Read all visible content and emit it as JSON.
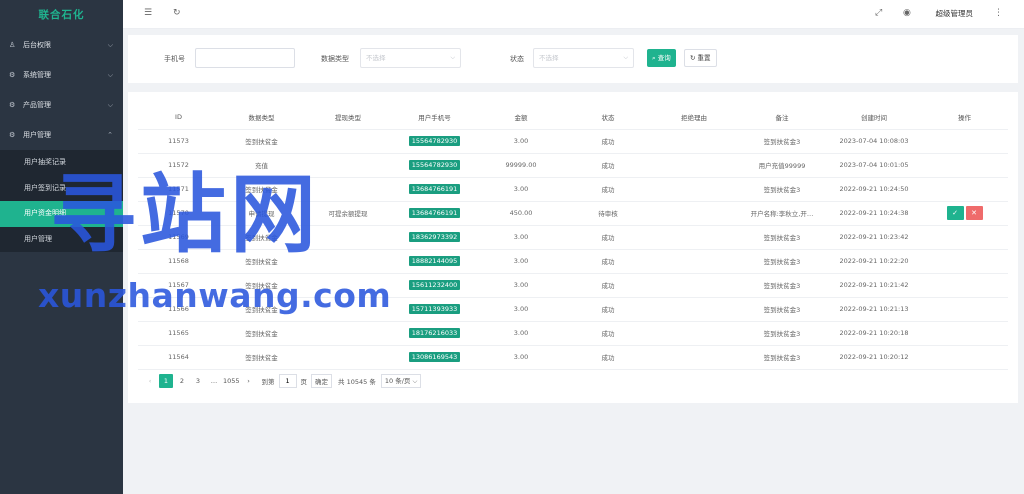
{
  "brand": "联合石化",
  "sidebar": {
    "menus": [
      {
        "label": "后台权限",
        "icon": "person-icon",
        "glyph": "♙",
        "chevron": "⌵"
      },
      {
        "label": "系统管理",
        "icon": "gear-icon",
        "glyph": "⚙",
        "chevron": "⌵"
      },
      {
        "label": "产品管理",
        "icon": "gear-icon",
        "glyph": "⚙",
        "chevron": "⌵"
      },
      {
        "label": "用户管理",
        "icon": "gear-icon",
        "glyph": "⚙",
        "chevron": "⌃"
      }
    ],
    "submenu": [
      "用户抽奖记录",
      "用户签到记录",
      "用户资金明细",
      "用户管理"
    ],
    "active_submenu": 2
  },
  "header": {
    "menu_toggle_glyph": "☰",
    "refresh_glyph": "↻",
    "fullscreen_glyph": "⤢",
    "theme_glyph": "◉",
    "user": "超级管理员",
    "more_glyph": "⋮"
  },
  "filter": {
    "phone_label": "手机号",
    "phone_value": "",
    "type_label": "数据类型",
    "type_placeholder": "不选择",
    "status_label": "状态",
    "status_placeholder": "不选择",
    "query_label": "查询",
    "reset_label": "重置",
    "search_glyph": "⌕",
    "reset_glyph": "↻",
    "dropdown_glyph": "⌵"
  },
  "table": {
    "columns": [
      "ID",
      "数据类型",
      "提现类型",
      "用户手机号",
      "金额",
      "状态",
      "拒绝理由",
      "备注",
      "创建时间",
      "操作"
    ],
    "rows": [
      {
        "id": "11573",
        "type": "签到扶贫金",
        "withdraw": "",
        "phone": "15564782930",
        "amount": "3.00",
        "status": "成功",
        "reason": "",
        "note": "签到扶贫金3",
        "time": "2023-07-04 10:08:03",
        "actions": false
      },
      {
        "id": "11572",
        "type": "充值",
        "withdraw": "",
        "phone": "15564782930",
        "amount": "99999.00",
        "status": "成功",
        "reason": "",
        "note": "用户充值99999",
        "time": "2023-07-04 10:01:05",
        "actions": false
      },
      {
        "id": "11571",
        "type": "签到扶贫金",
        "withdraw": "",
        "phone": "13684766191",
        "amount": "3.00",
        "status": "成功",
        "reason": "",
        "note": "签到扶贫金3",
        "time": "2022-09-21 10:24:50",
        "actions": false
      },
      {
        "id": "11570",
        "type": "申请提现",
        "withdraw": "可提余额提现",
        "phone": "13684766191",
        "amount": "450.00",
        "status": "待审核",
        "reason": "",
        "note": "开户名称:李秋立,开…",
        "time": "2022-09-21 10:24:38",
        "actions": true
      },
      {
        "id": "11569",
        "type": "签到扶贫金",
        "withdraw": "",
        "phone": "18362973392",
        "amount": "3.00",
        "status": "成功",
        "reason": "",
        "note": "签到扶贫金3",
        "time": "2022-09-21 10:23:42",
        "actions": false
      },
      {
        "id": "11568",
        "type": "签到扶贫金",
        "withdraw": "",
        "phone": "18882144095",
        "amount": "3.00",
        "status": "成功",
        "reason": "",
        "note": "签到扶贫金3",
        "time": "2022-09-21 10:22:20",
        "actions": false
      },
      {
        "id": "11567",
        "type": "签到扶贫金",
        "withdraw": "",
        "phone": "15611232400",
        "amount": "3.00",
        "status": "成功",
        "reason": "",
        "note": "签到扶贫金3",
        "time": "2022-09-21 10:21:42",
        "actions": false
      },
      {
        "id": "11566",
        "type": "签到扶贫金",
        "withdraw": "",
        "phone": "15711393933",
        "amount": "3.00",
        "status": "成功",
        "reason": "",
        "note": "签到扶贫金3",
        "time": "2022-09-21 10:21:13",
        "actions": false
      },
      {
        "id": "11565",
        "type": "签到扶贫金",
        "withdraw": "",
        "phone": "18176216033",
        "amount": "3.00",
        "status": "成功",
        "reason": "",
        "note": "签到扶贫金3",
        "time": "2022-09-21 10:20:18",
        "actions": false
      },
      {
        "id": "11564",
        "type": "签到扶贫金",
        "withdraw": "",
        "phone": "13086169543",
        "amount": "3.00",
        "status": "成功",
        "reason": "",
        "note": "签到扶贫金3",
        "time": "2022-09-21 10:20:12",
        "actions": false
      }
    ],
    "approve_glyph": "✓",
    "reject_glyph": "✕"
  },
  "pagination": {
    "prev_glyph": "‹",
    "next_glyph": "›",
    "pages": [
      "1",
      "2",
      "3",
      "…",
      "1055"
    ],
    "current": "1",
    "goto_label": "到第",
    "goto_value": "1",
    "page_unit": "页",
    "confirm_label": "确定",
    "total": "共 10545 条",
    "page_size": "10 条/页",
    "page_size_glyph": "⌵"
  },
  "watermark": {
    "big": "寻站网",
    "small": "xunzhanwang.com"
  },
  "colors": {
    "accent": "#1fb38f",
    "sidebar_bg": "#2b3542",
    "reject": "#ef6b6b",
    "phone_tag": "#1a9e80"
  }
}
